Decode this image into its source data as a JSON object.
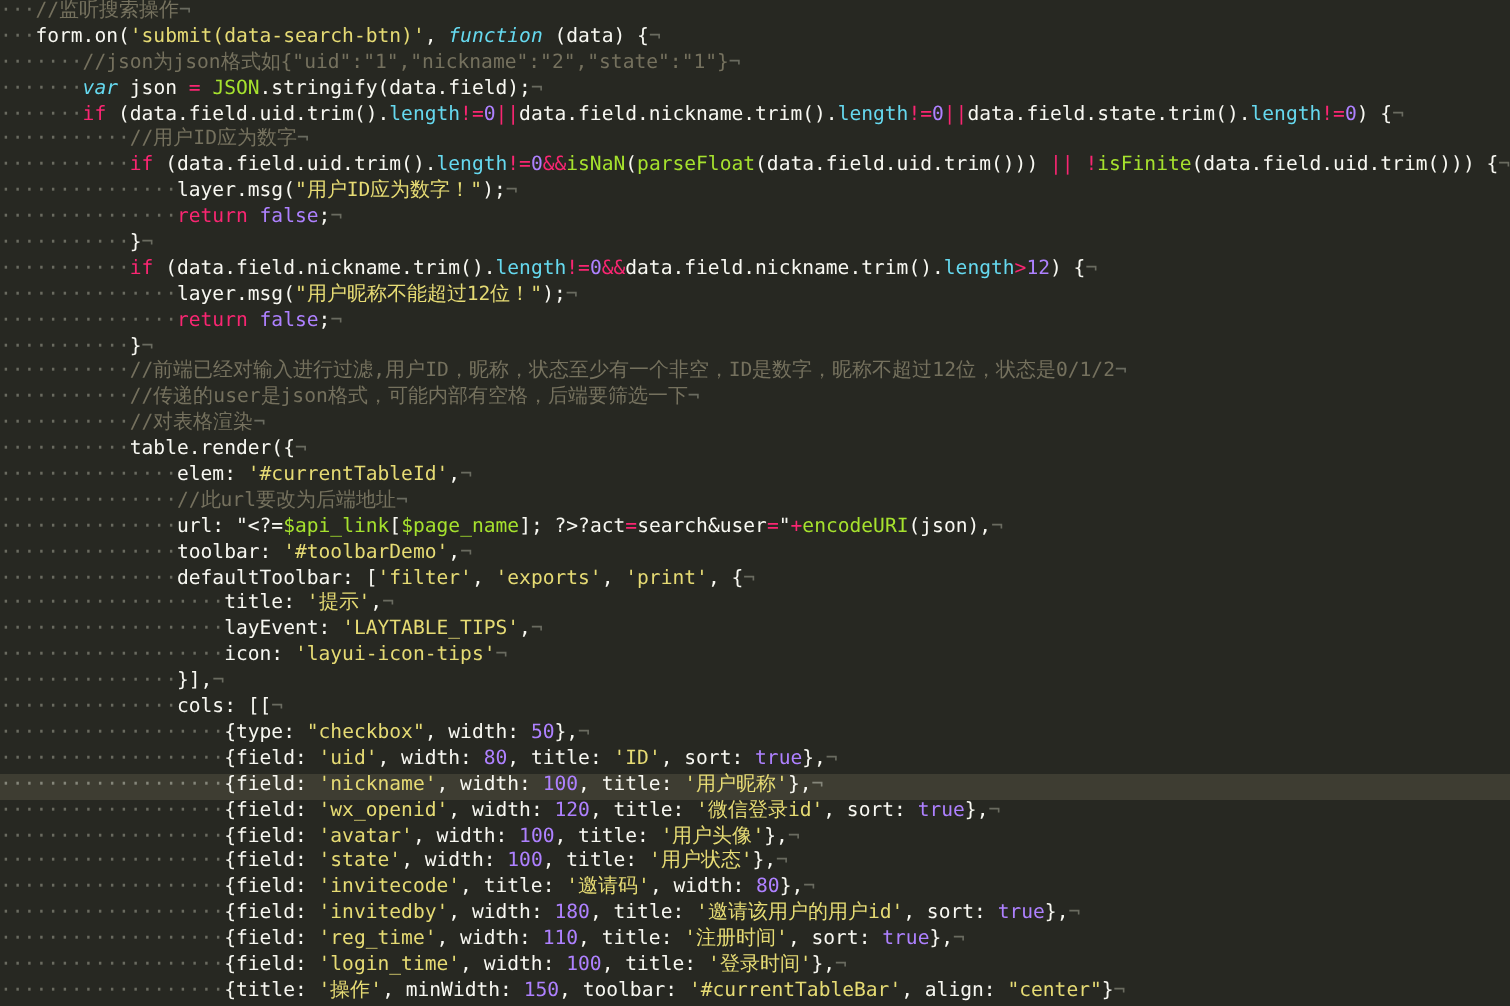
{
  "editor": {
    "lines": [
      {
        "indent": "···",
        "highlighted": false,
        "tokens": [
          {
            "kind": "comment",
            "text": "//监听搜索操作"
          },
          {
            "kind": "eol",
            "text": "¬"
          }
        ]
      },
      {
        "indent": "···",
        "highlighted": false,
        "tokens": [
          {
            "kind": "plain",
            "text": "form.on("
          },
          {
            "kind": "string",
            "text": "'submit(data-search-btn)'"
          },
          {
            "kind": "plain",
            "text": ", "
          },
          {
            "kind": "storage",
            "text": "function"
          },
          {
            "kind": "plain",
            "text": " (data) {"
          },
          {
            "kind": "eol",
            "text": "¬"
          }
        ]
      },
      {
        "indent": "·······",
        "highlighted": false,
        "tokens": [
          {
            "kind": "comment",
            "text": "//json为json格式如{\"uid\":\"1\",\"nickname\":\"2\",\"state\":\"1\"}"
          },
          {
            "kind": "eol",
            "text": "¬"
          }
        ]
      },
      {
        "indent": "·······",
        "highlighted": false,
        "tokens": [
          {
            "kind": "storage",
            "text": "var"
          },
          {
            "kind": "plain",
            "text": " json "
          },
          {
            "kind": "keyword",
            "text": "= "
          },
          {
            "kind": "builtin",
            "text": "JSON"
          },
          {
            "kind": "plain",
            "text": ".stringify(data.field);"
          },
          {
            "kind": "eol",
            "text": "¬"
          }
        ]
      },
      {
        "indent": "·······",
        "highlighted": false,
        "tokens": [
          {
            "kind": "keyword",
            "text": "if"
          },
          {
            "kind": "plain",
            "text": " (data.field.uid.trim()."
          },
          {
            "kind": "property",
            "text": "length"
          },
          {
            "kind": "keyword",
            "text": "!="
          },
          {
            "kind": "number",
            "text": "0"
          },
          {
            "kind": "keyword",
            "text": "||"
          },
          {
            "kind": "plain",
            "text": "data.field.nickname.trim()."
          },
          {
            "kind": "property",
            "text": "length"
          },
          {
            "kind": "keyword",
            "text": "!="
          },
          {
            "kind": "number",
            "text": "0"
          },
          {
            "kind": "keyword",
            "text": "||"
          },
          {
            "kind": "plain",
            "text": "data.field.state.trim()."
          },
          {
            "kind": "property",
            "text": "length"
          },
          {
            "kind": "keyword",
            "text": "!="
          },
          {
            "kind": "number",
            "text": "0"
          },
          {
            "kind": "plain",
            "text": ") {"
          },
          {
            "kind": "eol",
            "text": "¬"
          }
        ]
      },
      {
        "indent": "···········",
        "highlighted": false,
        "tokens": [
          {
            "kind": "comment",
            "text": "//用户ID应为数字"
          },
          {
            "kind": "eol",
            "text": "¬"
          }
        ]
      },
      {
        "indent": "···········",
        "highlighted": false,
        "tokens": [
          {
            "kind": "keyword",
            "text": "if"
          },
          {
            "kind": "plain",
            "text": " (data.field.uid.trim()."
          },
          {
            "kind": "property",
            "text": "length"
          },
          {
            "kind": "keyword",
            "text": "!="
          },
          {
            "kind": "number",
            "text": "0"
          },
          {
            "kind": "keyword",
            "text": "&&"
          },
          {
            "kind": "builtin",
            "text": "isNaN"
          },
          {
            "kind": "plain",
            "text": "("
          },
          {
            "kind": "builtin",
            "text": "parseFloat"
          },
          {
            "kind": "plain",
            "text": "(data.field.uid.trim())) "
          },
          {
            "kind": "keyword",
            "text": "|| !"
          },
          {
            "kind": "builtin",
            "text": "isFinite"
          },
          {
            "kind": "plain",
            "text": "(data.field.uid.trim())) {"
          },
          {
            "kind": "eol",
            "text": "¬"
          }
        ]
      },
      {
        "indent": "···············",
        "highlighted": false,
        "tokens": [
          {
            "kind": "plain",
            "text": "layer.msg("
          },
          {
            "kind": "string",
            "text": "\"用户ID应为数字！\""
          },
          {
            "kind": "plain",
            "text": ");"
          },
          {
            "kind": "eol",
            "text": "¬"
          }
        ]
      },
      {
        "indent": "···············",
        "highlighted": false,
        "tokens": [
          {
            "kind": "keyword",
            "text": "return "
          },
          {
            "kind": "number",
            "text": "false"
          },
          {
            "kind": "plain",
            "text": ";"
          },
          {
            "kind": "eol",
            "text": "¬"
          }
        ]
      },
      {
        "indent": "···········",
        "highlighted": false,
        "tokens": [
          {
            "kind": "plain",
            "text": "}"
          },
          {
            "kind": "eol",
            "text": "¬"
          }
        ]
      },
      {
        "indent": "···········",
        "highlighted": false,
        "tokens": [
          {
            "kind": "keyword",
            "text": "if"
          },
          {
            "kind": "plain",
            "text": " (data.field.nickname.trim()."
          },
          {
            "kind": "property",
            "text": "length"
          },
          {
            "kind": "keyword",
            "text": "!="
          },
          {
            "kind": "number",
            "text": "0"
          },
          {
            "kind": "keyword",
            "text": "&&"
          },
          {
            "kind": "plain",
            "text": "data.field.nickname.trim()."
          },
          {
            "kind": "property",
            "text": "length"
          },
          {
            "kind": "keyword",
            "text": ">"
          },
          {
            "kind": "number",
            "text": "12"
          },
          {
            "kind": "plain",
            "text": ") {"
          },
          {
            "kind": "eol",
            "text": "¬"
          }
        ]
      },
      {
        "indent": "···············",
        "highlighted": false,
        "tokens": [
          {
            "kind": "plain",
            "text": "layer.msg("
          },
          {
            "kind": "string",
            "text": "\"用户昵称不能超过12位！\""
          },
          {
            "kind": "plain",
            "text": ");"
          },
          {
            "kind": "eol",
            "text": "¬"
          }
        ]
      },
      {
        "indent": "···············",
        "highlighted": false,
        "tokens": [
          {
            "kind": "keyword",
            "text": "return "
          },
          {
            "kind": "number",
            "text": "false"
          },
          {
            "kind": "plain",
            "text": ";"
          },
          {
            "kind": "eol",
            "text": "¬"
          }
        ]
      },
      {
        "indent": "···········",
        "highlighted": false,
        "tokens": [
          {
            "kind": "plain",
            "text": "}"
          },
          {
            "kind": "eol",
            "text": "¬"
          }
        ]
      },
      {
        "indent": "···········",
        "highlighted": false,
        "tokens": [
          {
            "kind": "comment",
            "text": "//前端已经对输入进行过滤,用户ID，昵称，状态至少有一个非空，ID是数字，昵称不超过12位，状态是0/1/2"
          },
          {
            "kind": "eol",
            "text": "¬"
          }
        ]
      },
      {
        "indent": "···········",
        "highlighted": false,
        "tokens": [
          {
            "kind": "comment",
            "text": "//传递的user是json格式，可能内部有空格，后端要筛选一下"
          },
          {
            "kind": "eol",
            "text": "¬"
          }
        ]
      },
      {
        "indent": "···········",
        "highlighted": false,
        "tokens": [
          {
            "kind": "comment",
            "text": "//对表格渲染"
          },
          {
            "kind": "eol",
            "text": "¬"
          }
        ]
      },
      {
        "indent": "···········",
        "highlighted": false,
        "tokens": [
          {
            "kind": "plain",
            "text": "table.render({"
          },
          {
            "kind": "eol",
            "text": "¬"
          }
        ]
      },
      {
        "indent": "···············",
        "highlighted": false,
        "tokens": [
          {
            "kind": "plain",
            "text": "elem: "
          },
          {
            "kind": "string",
            "text": "'#currentTableId'"
          },
          {
            "kind": "plain",
            "text": ","
          },
          {
            "kind": "eol",
            "text": "¬"
          }
        ]
      },
      {
        "indent": "···············",
        "highlighted": false,
        "tokens": [
          {
            "kind": "comment",
            "text": "//此url要改为后端地址"
          },
          {
            "kind": "eol",
            "text": "¬"
          }
        ]
      },
      {
        "indent": "···············",
        "highlighted": false,
        "tokens": [
          {
            "kind": "plain",
            "text": "url: \"<?="
          },
          {
            "kind": "builtin",
            "text": "$api_link"
          },
          {
            "kind": "plain",
            "text": "["
          },
          {
            "kind": "builtin",
            "text": "$page_name"
          },
          {
            "kind": "plain",
            "text": "]; ?>?act"
          },
          {
            "kind": "keyword",
            "text": "="
          },
          {
            "kind": "plain",
            "text": "search&user"
          },
          {
            "kind": "keyword",
            "text": "="
          },
          {
            "kind": "plain",
            "text": "\""
          },
          {
            "kind": "keyword",
            "text": "+"
          },
          {
            "kind": "builtin",
            "text": "encodeURI"
          },
          {
            "kind": "plain",
            "text": "(json),"
          },
          {
            "kind": "eol",
            "text": "¬"
          }
        ]
      },
      {
        "indent": "···············",
        "highlighted": false,
        "tokens": [
          {
            "kind": "plain",
            "text": "toolbar: "
          },
          {
            "kind": "string",
            "text": "'#toolbarDemo'"
          },
          {
            "kind": "plain",
            "text": ","
          },
          {
            "kind": "eol",
            "text": "¬"
          }
        ]
      },
      {
        "indent": "···············",
        "highlighted": false,
        "tokens": [
          {
            "kind": "plain",
            "text": "defaultToolbar: ["
          },
          {
            "kind": "string",
            "text": "'filter'"
          },
          {
            "kind": "plain",
            "text": ", "
          },
          {
            "kind": "string",
            "text": "'exports'"
          },
          {
            "kind": "plain",
            "text": ", "
          },
          {
            "kind": "string",
            "text": "'print'"
          },
          {
            "kind": "plain",
            "text": ", {"
          },
          {
            "kind": "eol",
            "text": "¬"
          }
        ]
      },
      {
        "indent": "···················",
        "highlighted": false,
        "tokens": [
          {
            "kind": "plain",
            "text": "title: "
          },
          {
            "kind": "string",
            "text": "'提示'"
          },
          {
            "kind": "plain",
            "text": ","
          },
          {
            "kind": "eol",
            "text": "¬"
          }
        ]
      },
      {
        "indent": "···················",
        "highlighted": false,
        "tokens": [
          {
            "kind": "plain",
            "text": "layEvent: "
          },
          {
            "kind": "string",
            "text": "'LAYTABLE_TIPS'"
          },
          {
            "kind": "plain",
            "text": ","
          },
          {
            "kind": "eol",
            "text": "¬"
          }
        ]
      },
      {
        "indent": "···················",
        "highlighted": false,
        "tokens": [
          {
            "kind": "plain",
            "text": "icon: "
          },
          {
            "kind": "string",
            "text": "'layui-icon-tips'"
          },
          {
            "kind": "eol",
            "text": "¬"
          }
        ]
      },
      {
        "indent": "···············",
        "highlighted": false,
        "tokens": [
          {
            "kind": "plain",
            "text": "}],"
          },
          {
            "kind": "eol",
            "text": "¬"
          }
        ]
      },
      {
        "indent": "···············",
        "highlighted": false,
        "tokens": [
          {
            "kind": "plain",
            "text": "cols: [["
          },
          {
            "kind": "eol",
            "text": "¬"
          }
        ]
      },
      {
        "indent": "···················",
        "highlighted": false,
        "tokens": [
          {
            "kind": "plain",
            "text": "{type: "
          },
          {
            "kind": "string",
            "text": "\"checkbox\""
          },
          {
            "kind": "plain",
            "text": ", width: "
          },
          {
            "kind": "number",
            "text": "50"
          },
          {
            "kind": "plain",
            "text": "},"
          },
          {
            "kind": "eol",
            "text": "¬"
          }
        ]
      },
      {
        "indent": "···················",
        "highlighted": false,
        "tokens": [
          {
            "kind": "plain",
            "text": "{field: "
          },
          {
            "kind": "string",
            "text": "'uid'"
          },
          {
            "kind": "plain",
            "text": ", width: "
          },
          {
            "kind": "number",
            "text": "80"
          },
          {
            "kind": "plain",
            "text": ", title: "
          },
          {
            "kind": "string",
            "text": "'ID'"
          },
          {
            "kind": "plain",
            "text": ", sort: "
          },
          {
            "kind": "number",
            "text": "true"
          },
          {
            "kind": "plain",
            "text": "},"
          },
          {
            "kind": "eol",
            "text": "¬"
          }
        ]
      },
      {
        "indent": "···················",
        "highlighted": true,
        "tokens": [
          {
            "kind": "plain",
            "text": "{field: "
          },
          {
            "kind": "string",
            "text": "'nickname'"
          },
          {
            "kind": "plain",
            "text": ", width: "
          },
          {
            "kind": "number",
            "text": "100"
          },
          {
            "kind": "plain",
            "text": ", title: "
          },
          {
            "kind": "string",
            "text": "'用户昵称'"
          },
          {
            "kind": "plain",
            "text": "},"
          },
          {
            "kind": "eol",
            "text": "¬"
          }
        ]
      },
      {
        "indent": "···················",
        "highlighted": false,
        "tokens": [
          {
            "kind": "plain",
            "text": "{field: "
          },
          {
            "kind": "string",
            "text": "'wx_openid'"
          },
          {
            "kind": "plain",
            "text": ", width: "
          },
          {
            "kind": "number",
            "text": "120"
          },
          {
            "kind": "plain",
            "text": ", title: "
          },
          {
            "kind": "string",
            "text": "'微信登录id'"
          },
          {
            "kind": "plain",
            "text": ", sort: "
          },
          {
            "kind": "number",
            "text": "true"
          },
          {
            "kind": "plain",
            "text": "},"
          },
          {
            "kind": "eol",
            "text": "¬"
          }
        ]
      },
      {
        "indent": "···················",
        "highlighted": false,
        "tokens": [
          {
            "kind": "plain",
            "text": "{field: "
          },
          {
            "kind": "string",
            "text": "'avatar'"
          },
          {
            "kind": "plain",
            "text": ", width: "
          },
          {
            "kind": "number",
            "text": "100"
          },
          {
            "kind": "plain",
            "text": ", title: "
          },
          {
            "kind": "string",
            "text": "'用户头像'"
          },
          {
            "kind": "plain",
            "text": "},"
          },
          {
            "kind": "eol",
            "text": "¬"
          }
        ]
      },
      {
        "indent": "···················",
        "highlighted": false,
        "tokens": [
          {
            "kind": "plain",
            "text": "{field: "
          },
          {
            "kind": "string",
            "text": "'state'"
          },
          {
            "kind": "plain",
            "text": ", width: "
          },
          {
            "kind": "number",
            "text": "100"
          },
          {
            "kind": "plain",
            "text": ", title: "
          },
          {
            "kind": "string",
            "text": "'用户状态'"
          },
          {
            "kind": "plain",
            "text": "},"
          },
          {
            "kind": "eol",
            "text": "¬"
          }
        ]
      },
      {
        "indent": "···················",
        "highlighted": false,
        "tokens": [
          {
            "kind": "plain",
            "text": "{field: "
          },
          {
            "kind": "string",
            "text": "'invitecode'"
          },
          {
            "kind": "plain",
            "text": ", title: "
          },
          {
            "kind": "string",
            "text": "'邀请码'"
          },
          {
            "kind": "plain",
            "text": ", width: "
          },
          {
            "kind": "number",
            "text": "80"
          },
          {
            "kind": "plain",
            "text": "},"
          },
          {
            "kind": "eol",
            "text": "¬"
          }
        ]
      },
      {
        "indent": "···················",
        "highlighted": false,
        "tokens": [
          {
            "kind": "plain",
            "text": "{field: "
          },
          {
            "kind": "string",
            "text": "'invitedby'"
          },
          {
            "kind": "plain",
            "text": ", width: "
          },
          {
            "kind": "number",
            "text": "180"
          },
          {
            "kind": "plain",
            "text": ", title: "
          },
          {
            "kind": "string",
            "text": "'邀请该用户的用户id'"
          },
          {
            "kind": "plain",
            "text": ", sort: "
          },
          {
            "kind": "number",
            "text": "true"
          },
          {
            "kind": "plain",
            "text": "},"
          },
          {
            "kind": "eol",
            "text": "¬"
          }
        ]
      },
      {
        "indent": "···················",
        "highlighted": false,
        "tokens": [
          {
            "kind": "plain",
            "text": "{field: "
          },
          {
            "kind": "string",
            "text": "'reg_time'"
          },
          {
            "kind": "plain",
            "text": ", width: "
          },
          {
            "kind": "number",
            "text": "110"
          },
          {
            "kind": "plain",
            "text": ", title: "
          },
          {
            "kind": "string",
            "text": "'注册时间'"
          },
          {
            "kind": "plain",
            "text": ", sort: "
          },
          {
            "kind": "number",
            "text": "true"
          },
          {
            "kind": "plain",
            "text": "},"
          },
          {
            "kind": "eol",
            "text": "¬"
          }
        ]
      },
      {
        "indent": "···················",
        "highlighted": false,
        "tokens": [
          {
            "kind": "plain",
            "text": "{field: "
          },
          {
            "kind": "string",
            "text": "'login_time'"
          },
          {
            "kind": "plain",
            "text": ", width: "
          },
          {
            "kind": "number",
            "text": "100"
          },
          {
            "kind": "plain",
            "text": ", title: "
          },
          {
            "kind": "string",
            "text": "'登录时间'"
          },
          {
            "kind": "plain",
            "text": "},"
          },
          {
            "kind": "eol",
            "text": "¬"
          }
        ]
      },
      {
        "indent": "···················",
        "highlighted": false,
        "tokens": [
          {
            "kind": "plain",
            "text": "{title: "
          },
          {
            "kind": "string",
            "text": "'操作'"
          },
          {
            "kind": "plain",
            "text": ", minWidth: "
          },
          {
            "kind": "number",
            "text": "150"
          },
          {
            "kind": "plain",
            "text": ", toolbar: "
          },
          {
            "kind": "string",
            "text": "'#currentTableBar'"
          },
          {
            "kind": "plain",
            "text": ", align: "
          },
          {
            "kind": "string",
            "text": "\"center\""
          },
          {
            "kind": "plain",
            "text": "}"
          },
          {
            "kind": "eol",
            "text": "¬"
          }
        ]
      }
    ]
  }
}
